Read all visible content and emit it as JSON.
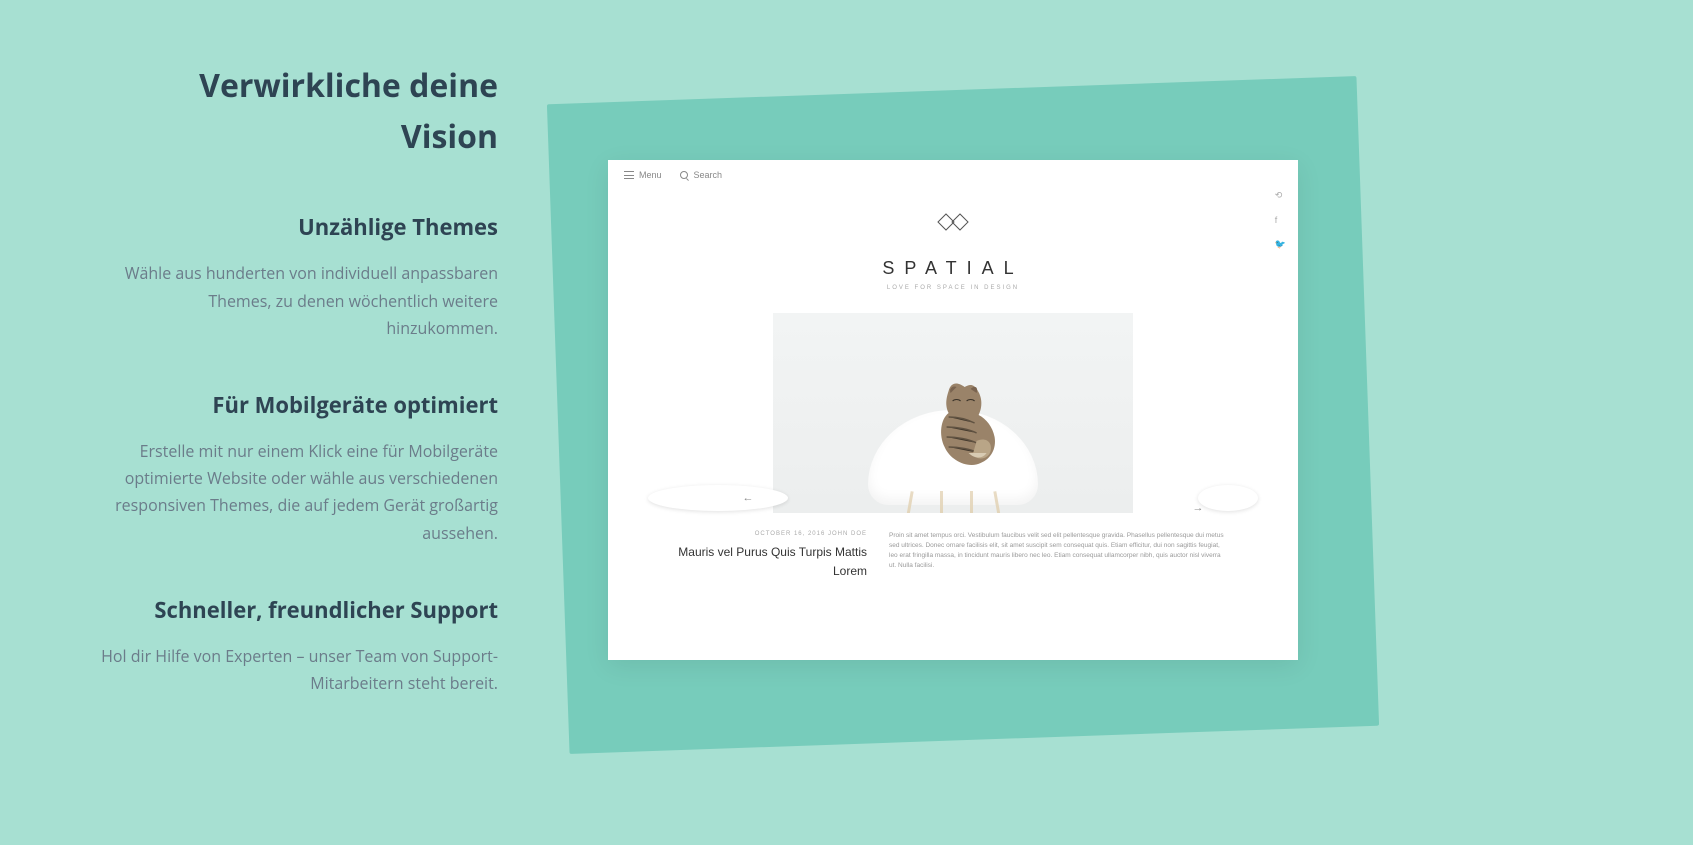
{
  "heading": "Verwirkliche deine Vision",
  "features": [
    {
      "title": "Unzählige Themes",
      "body": "Wähle aus hunderten von individuell anpassbaren Themes, zu denen wöchentlich weitere hinzukommen."
    },
    {
      "title": "Für Mobilgeräte optimiert",
      "body": "Erstelle mit nur einem Klick eine für Mobilgeräte optimierte Website oder wähle aus verschiedenen responsiven Themes, die auf jedem Gerät großartig aussehen."
    },
    {
      "title": "Schneller, freundlicher Support",
      "body": "Hol dir Hilfe von Experten – unser Team von Support-Mitarbeitern steht bereit."
    }
  ],
  "preview": {
    "menu": "Menu",
    "search": "Search",
    "brand": "SPATIAL",
    "tagline": "LOVE FOR SPACE IN DESIGN",
    "post": {
      "meta": "OCTOBER 16, 2016   JOHN DOE",
      "title": "Mauris vel Purus Quis Turpis Mattis Lorem",
      "body": "Proin sit amet tempus orci. Vestibulum faucibus velit sed elit pellentesque gravida. Phasellus pellentesque dui metus sed ultrices. Donec ornare facilisis elit, sit amet suscipit sem consequat quis. Etiam efficitur, dui non sagittis feugiat, leo erat fringilla massa, in tincidunt mauris libero nec leo. Etiam consequat ullamcorper nibh, quis auctor nisl viverra ut. Nulla facilisi."
    }
  }
}
